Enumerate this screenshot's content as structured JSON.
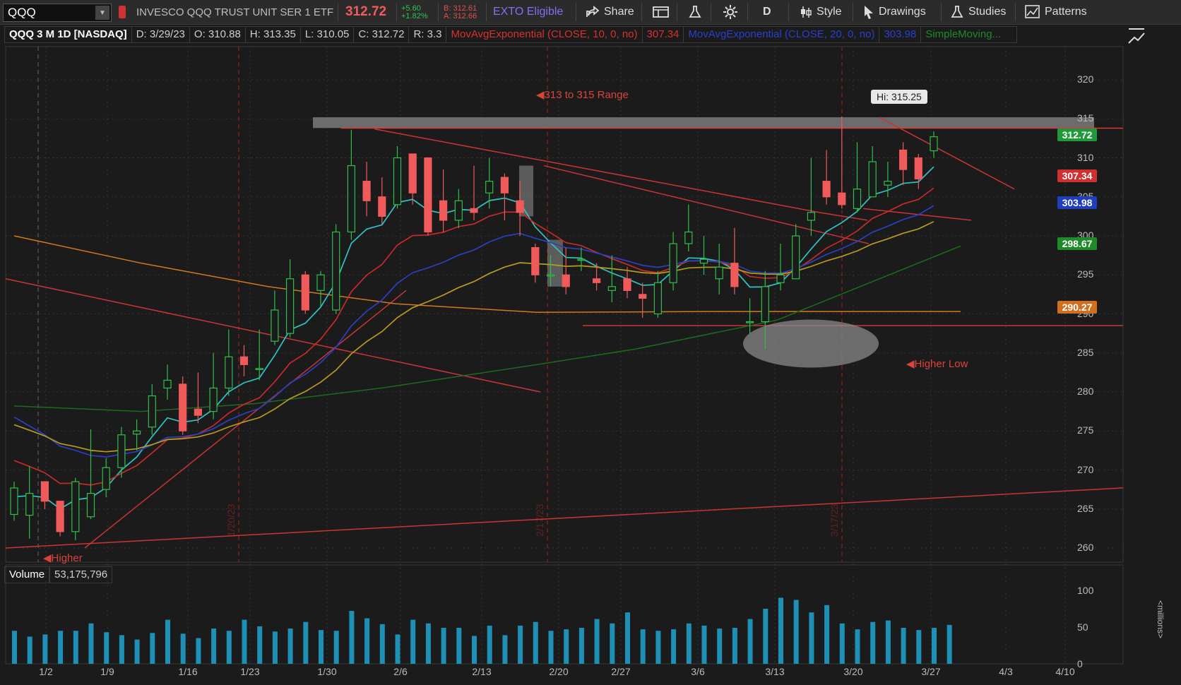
{
  "toolbar": {
    "symbol": "QQQ",
    "description": "INVESCO QQQ TRUST UNIT SER 1 ETF",
    "last_price": "312.72",
    "change": "+5.60",
    "change_pct": "+1.82%",
    "bid": "B: 312.61",
    "ask": "A: 312.66",
    "exto": "EXTO Eligible",
    "share": "Share",
    "aggregation": "D",
    "style": "Style",
    "drawings": "Drawings",
    "studies": "Studies",
    "patterns": "Patterns"
  },
  "infobar": {
    "title": "QQQ 3 M 1D [NASDAQ]",
    "date": "D: 3/29/23",
    "open": "O: 310.88",
    "high": "H: 313.35",
    "low": "L: 310.05",
    "close": "C: 312.72",
    "range": "R: 3.3",
    "ema10_label": "MovAvgExponential (CLOSE, 10, 0, no)",
    "ema10_value": "307.34",
    "ema20_label": "MovAvgExponential (CLOSE, 20, 0, no)",
    "ema20_value": "303.98",
    "sma_label": "SimpleMoving..."
  },
  "price_axis": {
    "ticks": [
      "320",
      "315",
      "310",
      "305",
      "300",
      "295",
      "290",
      "285",
      "280",
      "275",
      "270",
      "265",
      "260"
    ],
    "tags": [
      {
        "value": "312.72",
        "color": "#1f9a3a"
      },
      {
        "value": "307.34",
        "color": "#d03030"
      },
      {
        "value": "303.98",
        "color": "#1f3fbf"
      },
      {
        "value": "298.67",
        "color": "#1f8a2a"
      },
      {
        "value": "290.27",
        "color": "#d0701f"
      }
    ]
  },
  "date_axis": {
    "ticks": [
      "1/2",
      "1/9",
      "1/16",
      "1/23",
      "1/30",
      "2/6",
      "2/13",
      "2/20",
      "2/27",
      "3/6",
      "3/13",
      "3/20",
      "3/27",
      "4/3",
      "4/10"
    ],
    "period_markers": [
      "1/20/23",
      "2/17/23",
      "3/17/23"
    ]
  },
  "annotations": {
    "range_label": "313 to 315 Range",
    "hi_label": "Hi: 315.25",
    "higher_low": "Higher Low",
    "higher_low_bottom": "Higher"
  },
  "volume": {
    "label": "Volume",
    "value": "53,175,796",
    "unit": "<millions>",
    "ticks": [
      "100",
      "50",
      "0"
    ]
  },
  "chart_data": {
    "type": "candlestick",
    "title": "QQQ 3 M 1D [NASDAQ]",
    "ylim": [
      258,
      323
    ],
    "volume_ylim": [
      0,
      100
    ],
    "dates": [
      "12/30",
      "1/3",
      "1/4",
      "1/5",
      "1/6",
      "1/9",
      "1/10",
      "1/11",
      "1/12",
      "1/13",
      "1/17",
      "1/18",
      "1/19",
      "1/20",
      "1/23",
      "1/24",
      "1/25",
      "1/26",
      "1/27",
      "1/30",
      "1/31",
      "2/1",
      "2/2",
      "2/3",
      "2/6",
      "2/7",
      "2/8",
      "2/9",
      "2/10",
      "2/13",
      "2/14",
      "2/15",
      "2/16",
      "2/17",
      "2/21",
      "2/22",
      "2/23",
      "2/24",
      "2/27",
      "2/28",
      "3/1",
      "3/2",
      "3/3",
      "3/6",
      "3/7",
      "3/8",
      "3/9",
      "3/10",
      "3/13",
      "3/14",
      "3/15",
      "3/16",
      "3/17",
      "3/20",
      "3/21",
      "3/22",
      "3/23",
      "3/24",
      "3/27",
      "3/28",
      "3/29"
    ],
    "open": [
      264.3,
      264.2,
      268.5,
      266.0,
      262.1,
      264.0,
      267.5,
      270.3,
      274.6,
      275.5,
      280.5,
      281.0,
      277.8,
      277.5,
      280.5,
      284.5,
      283.0,
      286.5,
      287.5,
      295.0,
      293.0,
      290.5,
      300.5,
      307.0,
      305.0,
      304.0,
      310.5,
      310.0,
      304.5,
      302.0,
      303.5,
      305.5,
      307.5,
      304.5,
      298.5,
      295.0,
      295.0,
      297.0,
      294.5,
      293.0,
      294.5,
      292.5,
      290.0,
      294.0,
      299.0,
      296.5,
      294.5,
      296.5,
      289.0,
      289.0,
      294.0,
      294.5,
      302.0,
      307.0,
      305.5,
      303.5,
      305.0,
      306.5,
      311.0,
      310.0,
      310.9
    ],
    "close": [
      267.7,
      267.0,
      266.0,
      262.1,
      268.5,
      267.0,
      270.3,
      274.5,
      275.0,
      279.5,
      281.5,
      275.0,
      277.0,
      280.5,
      284.5,
      283.5,
      283.0,
      290.5,
      294.5,
      290.5,
      295.0,
      300.5,
      309.0,
      304.5,
      302.5,
      310.0,
      305.5,
      300.5,
      302.0,
      304.5,
      303.0,
      307.0,
      305.5,
      303.0,
      295.0,
      295.0,
      293.5,
      297.0,
      294.0,
      293.5,
      293.0,
      292.0,
      294.0,
      299.0,
      300.5,
      297.0,
      296.0,
      293.5,
      289.0,
      293.5,
      295.0,
      300.0,
      303.0,
      305.0,
      304.0,
      306.0,
      309.5,
      307.0,
      308.5,
      307.3,
      312.7
    ],
    "high": [
      268.5,
      270.5,
      268.5,
      266.0,
      269.0,
      275.2,
      271.5,
      275.5,
      276.5,
      281.0,
      283.5,
      282.0,
      282.5,
      285.0,
      288.0,
      286.0,
      288.0,
      293.0,
      297.0,
      295.5,
      295.5,
      301.5,
      313.6,
      309.5,
      307.5,
      311.5,
      310.5,
      306.5,
      308.5,
      306.0,
      309.0,
      310.0,
      308.0,
      307.0,
      299.0,
      297.5,
      298.5,
      298.5,
      296.5,
      297.5,
      296.0,
      294.0,
      295.5,
      300.5,
      304.0,
      300.0,
      299.0,
      301.0,
      292.0,
      295.5,
      299.0,
      301.5,
      310.0,
      311.0,
      315.3,
      312.0,
      311.5,
      309.5,
      312.0,
      310.5,
      313.4
    ],
    "low": [
      263.5,
      261.2,
      265.0,
      261.5,
      261.0,
      263.7,
      266.5,
      269.0,
      272.5,
      274.5,
      279.0,
      274.5,
      276.0,
      276.5,
      279.5,
      282.0,
      281.5,
      286.0,
      287.0,
      290.0,
      291.0,
      290.0,
      299.5,
      302.5,
      301.5,
      303.5,
      304.0,
      300.0,
      300.5,
      301.0,
      302.0,
      303.5,
      302.0,
      300.0,
      294.0,
      293.5,
      292.5,
      295.5,
      293.0,
      291.5,
      292.0,
      289.5,
      289.5,
      293.0,
      298.0,
      295.0,
      292.5,
      292.5,
      287.5,
      285.5,
      293.0,
      294.5,
      300.0,
      304.0,
      303.5,
      303.0,
      305.0,
      305.0,
      306.5,
      306.0,
      310.0
    ],
    "volume": [
      45,
      37,
      40,
      45,
      45,
      55,
      43,
      39,
      33,
      42,
      60,
      41,
      35,
      48,
      45,
      60,
      51,
      44,
      48,
      57,
      46,
      45,
      72,
      62,
      54,
      40,
      60,
      55,
      49,
      49,
      38,
      52,
      39,
      52,
      57,
      45,
      47,
      49,
      61,
      55,
      70,
      47,
      45,
      47,
      55,
      52,
      48,
      49,
      61,
      75,
      90,
      87,
      70,
      80,
      55,
      47,
      57,
      59,
      49,
      46,
      49,
      53
    ],
    "series": [
      {
        "name": "MovAvgExponential (CLOSE, 10, 0, no)",
        "color": "#2ec4c4"
      },
      {
        "name": "MovAvgExponential (CLOSE, 20, 0, no)",
        "color": "#cc2a2a"
      },
      {
        "name": "SimpleMoving...",
        "color": "#2a40c0"
      }
    ]
  }
}
